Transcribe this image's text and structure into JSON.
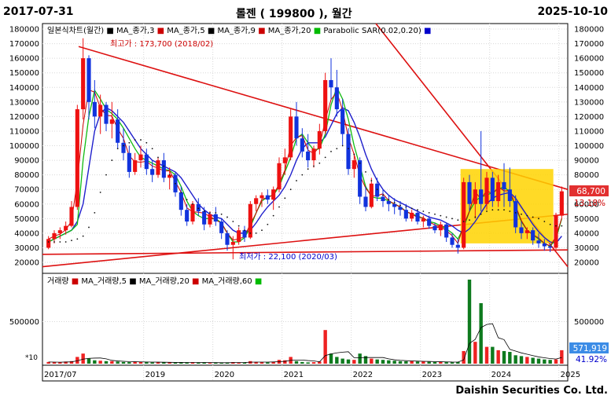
{
  "header": {
    "start_date": "2017-07-31",
    "title": "롤젠 ( 199800 ), 월간",
    "end_date": "2025-10-10"
  },
  "footer": {
    "brand": "Daishin Securities Co. Ltd."
  },
  "chart_data": {
    "type": "candlestick",
    "price_axis": {
      "min": 20000,
      "max": 180000,
      "step": 10000,
      "ticks": [
        "20000",
        "30000",
        "40000",
        "50000",
        "60000",
        "70000",
        "80000",
        "90000",
        "100000",
        "110000",
        "120000",
        "130000",
        "140000",
        "150000",
        "160000",
        "170000",
        "180000"
      ]
    },
    "volume_axis": {
      "ticks": [
        "500000"
      ],
      "multiplier_label": "*10"
    },
    "x_labels": [
      "2017/07",
      "2019",
      "2020",
      "2021",
      "2022",
      "2023",
      "2024",
      "2025"
    ],
    "price_legend": [
      {
        "label": "일본식차트(월간)",
        "color": "#000000"
      },
      {
        "label": "MA_종가,3",
        "color": "#cc0000"
      },
      {
        "label": "MA_종가,5",
        "color": "#000000"
      },
      {
        "label": "MA_종가,9",
        "color": "#cc0000"
      },
      {
        "label": "MA_종가,20",
        "color": "#00bb00"
      },
      {
        "label": "Parabolic SAR(0.02,0.20)",
        "color": "#0000cc"
      }
    ],
    "volume_legend": [
      {
        "label": "거래량",
        "color": "#cc0000"
      },
      {
        "label": "MA_거래량,5",
        "color": "#000000"
      },
      {
        "label": "MA_거래량,20",
        "color": "#cc0000"
      },
      {
        "label": "MA_거래량,60",
        "color": "#00bb00"
      }
    ],
    "annotations": {
      "high": "최고가 : 173,700 (2018/02)",
      "low": "최저가 : 22,100 (2020/03)"
    },
    "last_price": {
      "value": "68,700",
      "change": "13.18%"
    },
    "last_volume": {
      "value": "571,919",
      "change": "41.92%"
    },
    "candles": [
      [
        30000,
        38000,
        29000,
        36000
      ],
      [
        36000,
        42000,
        33000,
        40000
      ],
      [
        40000,
        44000,
        36000,
        42000
      ],
      [
        42000,
        48000,
        39000,
        45000
      ],
      [
        45000,
        62000,
        44000,
        58000
      ],
      [
        58000,
        128000,
        56000,
        125000
      ],
      [
        125000,
        173700,
        118000,
        160000
      ],
      [
        160000,
        162000,
        118000,
        130000
      ],
      [
        130000,
        145000,
        112000,
        120000
      ],
      [
        120000,
        135000,
        108000,
        128000
      ],
      [
        128000,
        130000,
        110000,
        115000
      ],
      [
        115000,
        130000,
        105000,
        118000
      ],
      [
        118000,
        125000,
        98000,
        102000
      ],
      [
        102000,
        112000,
        90000,
        95000
      ],
      [
        95000,
        100000,
        78000,
        82000
      ],
      [
        82000,
        95000,
        80000,
        90000
      ],
      [
        90000,
        100000,
        85000,
        94000
      ],
      [
        94000,
        98000,
        80000,
        84000
      ],
      [
        84000,
        90000,
        75000,
        80000
      ],
      [
        80000,
        92000,
        78000,
        90000
      ],
      [
        90000,
        95000,
        75000,
        78000
      ],
      [
        78000,
        85000,
        70000,
        80000
      ],
      [
        80000,
        82000,
        65000,
        68000
      ],
      [
        68000,
        72000,
        52000,
        56000
      ],
      [
        56000,
        60000,
        45000,
        48000
      ],
      [
        48000,
        62000,
        46000,
        60000
      ],
      [
        60000,
        64000,
        52000,
        55000
      ],
      [
        55000,
        58000,
        42000,
        46000
      ],
      [
        46000,
        55000,
        44000,
        53000
      ],
      [
        53000,
        58000,
        45000,
        48000
      ],
      [
        48000,
        50000,
        36000,
        40000
      ],
      [
        40000,
        42000,
        28000,
        32000
      ],
      [
        32000,
        38000,
        22100,
        34000
      ],
      [
        34000,
        44000,
        32000,
        42000
      ],
      [
        42000,
        45000,
        34000,
        37000
      ],
      [
        37000,
        62000,
        36000,
        60000
      ],
      [
        60000,
        66000,
        55000,
        64000
      ],
      [
        64000,
        68000,
        58000,
        66000
      ],
      [
        66000,
        70000,
        60000,
        63000
      ],
      [
        63000,
        72000,
        56000,
        70000
      ],
      [
        70000,
        92000,
        68000,
        88000
      ],
      [
        88000,
        98000,
        80000,
        92000
      ],
      [
        92000,
        125000,
        90000,
        120000
      ],
      [
        120000,
        130000,
        100000,
        105000
      ],
      [
        105000,
        112000,
        92000,
        96000
      ],
      [
        96000,
        108000,
        85000,
        90000
      ],
      [
        90000,
        100000,
        85000,
        98000
      ],
      [
        98000,
        115000,
        94000,
        110000
      ],
      [
        110000,
        150000,
        108000,
        145000
      ],
      [
        145000,
        160000,
        132000,
        140000
      ],
      [
        140000,
        152000,
        120000,
        125000
      ],
      [
        125000,
        132000,
        100000,
        108000
      ],
      [
        108000,
        112000,
        80000,
        84000
      ],
      [
        84000,
        95000,
        78000,
        90000
      ],
      [
        90000,
        92000,
        60000,
        65000
      ],
      [
        65000,
        72000,
        55000,
        58000
      ],
      [
        58000,
        78000,
        57000,
        74000
      ],
      [
        74000,
        78000,
        62000,
        65000
      ],
      [
        65000,
        70000,
        58000,
        62000
      ],
      [
        62000,
        66000,
        55000,
        60000
      ],
      [
        60000,
        64000,
        53000,
        58000
      ],
      [
        58000,
        62000,
        52000,
        56000
      ],
      [
        56000,
        60000,
        48000,
        50000
      ],
      [
        50000,
        56000,
        48000,
        54000
      ],
      [
        54000,
        56000,
        46000,
        48000
      ],
      [
        48000,
        52000,
        44000,
        50000
      ],
      [
        50000,
        52000,
        43000,
        45000
      ],
      [
        45000,
        47000,
        40000,
        42000
      ],
      [
        42000,
        48000,
        38000,
        46000
      ],
      [
        46000,
        47000,
        34000,
        37000
      ],
      [
        37000,
        40000,
        30000,
        32000
      ],
      [
        32000,
        36000,
        26000,
        30000
      ],
      [
        30000,
        78000,
        29000,
        75000
      ],
      [
        75000,
        80000,
        55000,
        60000
      ],
      [
        60000,
        75000,
        50000,
        70000
      ],
      [
        70000,
        110000,
        55000,
        60000
      ],
      [
        60000,
        82000,
        56000,
        78000
      ],
      [
        78000,
        82000,
        58000,
        62000
      ],
      [
        62000,
        80000,
        58000,
        75000
      ],
      [
        75000,
        88000,
        58000,
        70000
      ],
      [
        70000,
        85000,
        58000,
        62000
      ],
      [
        62000,
        66000,
        40000,
        44000
      ],
      [
        44000,
        48000,
        36000,
        40000
      ],
      [
        40000,
        44000,
        36000,
        42000
      ],
      [
        42000,
        44000,
        32000,
        35000
      ],
      [
        35000,
        40000,
        30000,
        33000
      ],
      [
        33000,
        36000,
        28000,
        31000
      ],
      [
        31000,
        33000,
        27000,
        30000
      ],
      [
        30000,
        54000,
        29000,
        52000
      ],
      [
        52000,
        72000,
        50000,
        68700
      ]
    ],
    "volumes": [
      20000,
      18000,
      15000,
      25000,
      30000,
      80000,
      120000,
      60000,
      40000,
      35000,
      30000,
      30000,
      25000,
      20000,
      18000,
      22000,
      20000,
      18000,
      15000,
      16000,
      15000,
      14000,
      12000,
      15000,
      14000,
      16000,
      12000,
      11000,
      12000,
      10000,
      10000,
      12000,
      18000,
      15000,
      12000,
      30000,
      20000,
      18000,
      15000,
      20000,
      45000,
      40000,
      80000,
      30000,
      20000,
      15000,
      18000,
      25000,
      400000,
      120000,
      80000,
      60000,
      50000,
      45000,
      120000,
      90000,
      60000,
      50000,
      45000,
      40000,
      35000,
      30000,
      28000,
      30000,
      25000,
      26000,
      22000,
      20000,
      20000,
      18000,
      16000,
      20000,
      150000,
      1000000,
      260000,
      720000,
      200000,
      200000,
      160000,
      150000,
      140000,
      100000,
      90000,
      80000,
      70000,
      60000,
      50000,
      45000,
      50000,
      160000
    ],
    "ma_fast": [
      34000,
      36000,
      38000,
      40000,
      42000,
      46000,
      90000,
      120000,
      138000,
      132000,
      125000,
      122000,
      118000,
      112000,
      105000,
      98000,
      92000,
      90000,
      88000,
      86000,
      84000,
      83000,
      80000,
      72000,
      62000,
      55000,
      52000,
      50000,
      50000,
      50000,
      47000,
      40000,
      34000,
      34000,
      37000,
      44000,
      54000,
      62000,
      65000,
      66000,
      72000,
      82000,
      92000,
      105000,
      108000,
      102000,
      97000,
      98000,
      108000,
      128000,
      140000,
      132000,
      118000,
      100000,
      86000,
      72000,
      65000,
      64000,
      64000,
      62000,
      60000,
      58000,
      55000,
      53000,
      52000,
      50000,
      48000,
      47000,
      45000,
      43000,
      40000,
      36000,
      44000,
      55000,
      62000,
      65000,
      66000,
      68000,
      70000,
      72000,
      68000,
      58000,
      48000,
      42000,
      39000,
      36000,
      33000,
      31000,
      36000,
      50000
    ],
    "ma_mid": [
      34000,
      36000,
      38000,
      40000,
      42000,
      48000,
      60000,
      85000,
      110000,
      122000,
      126000,
      124000,
      120000,
      116000,
      110000,
      104000,
      98000,
      94000,
      90000,
      88000,
      86000,
      84000,
      82000,
      78000,
      72000,
      66000,
      60000,
      56000,
      53000,
      51000,
      50000,
      46000,
      42000,
      40000,
      40000,
      42000,
      47000,
      53000,
      58000,
      62000,
      66000,
      72000,
      80000,
      90000,
      98000,
      102000,
      102000,
      102000,
      106000,
      114000,
      122000,
      126000,
      124000,
      116000,
      106000,
      94000,
      84000,
      76000,
      70000,
      66000,
      63000,
      61000,
      59000,
      57000,
      55000,
      53000,
      51000,
      50000,
      49000,
      47000,
      45000,
      42000,
      40000,
      43000,
      48000,
      54000,
      60000,
      64000,
      66000,
      67000,
      68000,
      64000,
      58000,
      52000,
      46000,
      41000,
      37000,
      34000,
      33000,
      38000
    ],
    "sar": [
      34000,
      34000,
      34000,
      34000,
      35000,
      36000,
      38000,
      44000,
      54000,
      68000,
      80000,
      90000,
      98000,
      100000,
      102000,
      104000,
      104000,
      102000,
      98000,
      92000,
      86000,
      80000,
      74000,
      68000,
      63000,
      60000,
      57000,
      55000,
      54000,
      54000,
      53000,
      51000,
      48000,
      45000,
      42000,
      40000,
      40000,
      42000,
      46000,
      52000,
      58000,
      64000,
      70000,
      76000,
      80000,
      84000,
      86000,
      88000,
      92000,
      96000,
      98000,
      100000,
      98000,
      94000,
      88000,
      82000,
      76000,
      70000,
      66000,
      63000,
      61000,
      59000,
      58000,
      57000,
      56000,
      55000,
      54000,
      53000,
      52000,
      51000,
      50000,
      49000,
      48000,
      49000,
      51000,
      53000,
      55000,
      56000,
      56000,
      56000,
      55000,
      54000,
      53000,
      52000,
      51000,
      50000,
      48000,
      46000,
      45000,
      45000
    ]
  }
}
